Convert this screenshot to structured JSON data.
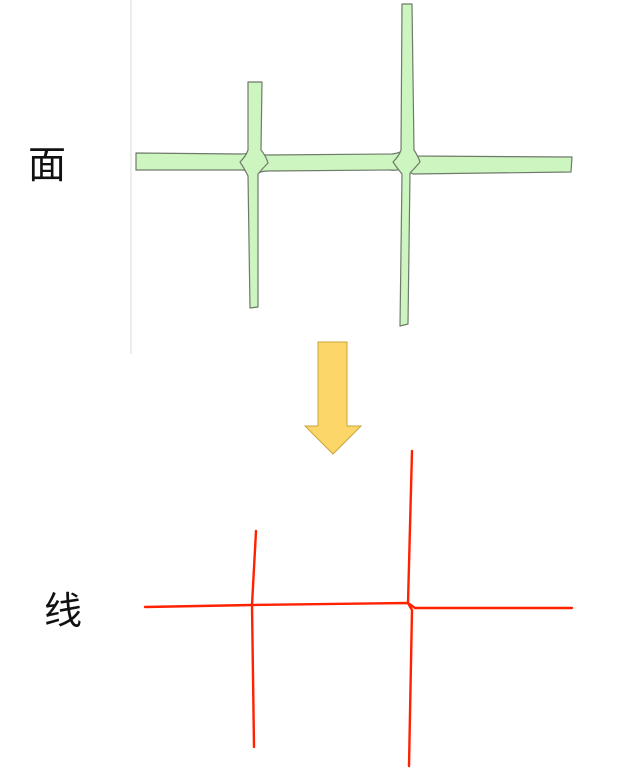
{
  "labels": {
    "polygon": "面",
    "line": "线"
  },
  "colors": {
    "polygon_fill": "#ccf5c0",
    "polygon_stroke": "#6f7a6a",
    "arrow_fill": "#fdd669",
    "arrow_stroke": "#c9a43a",
    "line_stroke": "#ff2200",
    "frame_line": "#d8d8d8"
  },
  "shapes": {
    "top": "road-polygons",
    "arrow": "down-arrow",
    "bottom": "centerlines"
  }
}
